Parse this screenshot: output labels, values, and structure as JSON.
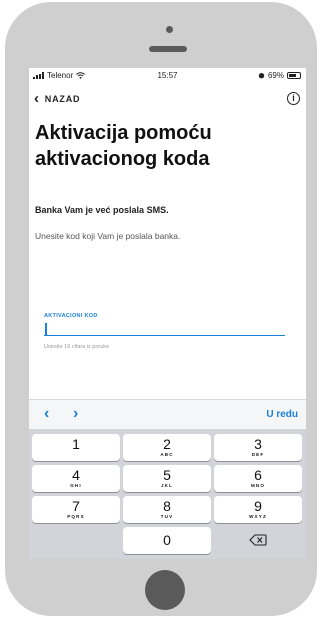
{
  "status_bar": {
    "carrier": "Telenor",
    "time": "15:57",
    "battery": "69%",
    "battery_level": 0.69
  },
  "nav": {
    "back_label": "NAZAD"
  },
  "page": {
    "title_line1": "Aktivacija pomoću",
    "title_line2": "aktivacionog koda",
    "notice": "Banka Vam je već poslala SMS.",
    "instruction": "Unesite kod koji Vam je poslala banka."
  },
  "field": {
    "label": "AKTIVACIONI KOD",
    "value": "",
    "hint": "Unesite 16 cifara iz poruke"
  },
  "toolbar": {
    "prev": "‹",
    "next": "›",
    "done": "U redu"
  },
  "keypad": {
    "keys": [
      {
        "number": "1",
        "letters": ""
      },
      {
        "number": "2",
        "letters": "ABC"
      },
      {
        "number": "3",
        "letters": "DEF"
      },
      {
        "number": "4",
        "letters": "GHI"
      },
      {
        "number": "5",
        "letters": "JKL"
      },
      {
        "number": "6",
        "letters": "MNO"
      },
      {
        "number": "7",
        "letters": "PQRS"
      },
      {
        "number": "8",
        "letters": "TUV"
      },
      {
        "number": "9",
        "letters": "WXYZ"
      },
      {
        "number": "0",
        "letters": ""
      }
    ]
  },
  "colors": {
    "accent": "#1a7fd9",
    "keyboard_bg": "#d2d4d9",
    "device": "#cfcfcf"
  }
}
